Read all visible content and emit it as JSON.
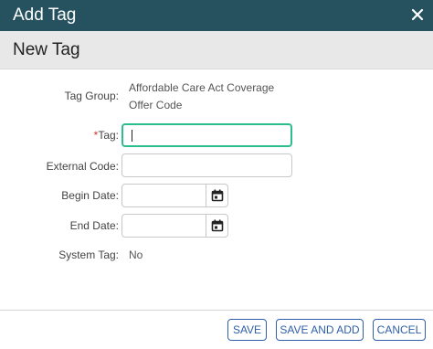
{
  "dialog": {
    "title": "Add Tag",
    "close_icon": "close-icon"
  },
  "section": {
    "title": "New Tag"
  },
  "form": {
    "tag_group": {
      "label": "Tag Group:",
      "value_line1": "Affordable Care Act Coverage",
      "value_line2": "Offer Code"
    },
    "tag": {
      "required_mark": "*",
      "label": "Tag:",
      "value": ""
    },
    "external_code": {
      "label": "External Code:",
      "value": ""
    },
    "begin_date": {
      "label": "Begin Date:",
      "value": "",
      "icon": "calendar-icon"
    },
    "end_date": {
      "label": "End Date:",
      "value": "",
      "icon": "calendar-icon"
    },
    "system_tag": {
      "label": "System Tag:",
      "value": "No"
    }
  },
  "footer": {
    "save_label": "SAVE",
    "save_and_add_label": "SAVE AND ADD",
    "cancel_label": "CANCEL"
  },
  "colors": {
    "titlebar": "#265260",
    "focus_border": "#2ebd8f",
    "button_accent": "#2e5fa8",
    "required": "#d0332c"
  }
}
